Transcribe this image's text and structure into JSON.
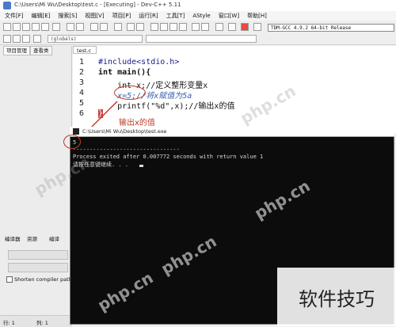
{
  "window": {
    "title": "C:\\Users\\Mi Wu\\Desktop\\test.c - [Executing] - Dev-C++ 5.11"
  },
  "menu": [
    "文件[F]",
    "编辑[E]",
    "搜索[S]",
    "视图[V]",
    "项目[P]",
    "运行[R]",
    "工具[T]",
    "AStyle",
    "窗口[W]",
    "帮助[H]"
  ],
  "toolbar": {
    "compiler": "TDM-GCC 4.9.2 64-bit Release",
    "scope": "(globals)"
  },
  "left_panel": {
    "tabs": [
      "项目管理",
      "查看类"
    ],
    "bottom_tabs": [
      "编译器",
      "资源",
      "编译"
    ],
    "shorten_label": "Shorten compiler paths",
    "status_line": "行:  1",
    "status_col": "列:  1"
  },
  "editor": {
    "tab": "test.c",
    "lines": [
      {
        "num": "1",
        "text": "#include<stdio.h>"
      },
      {
        "num": "2",
        "text": "int main(){"
      },
      {
        "num": "3",
        "text": "    int x;//定义整形变量x"
      },
      {
        "num": "4",
        "text": "    x=5;//将x赋值为5a"
      },
      {
        "num": "5",
        "text": "    printf(\"%d\",x);//输出x的值"
      },
      {
        "num": "6",
        "text": "}"
      }
    ]
  },
  "annotation": {
    "label": "输出x的值"
  },
  "console": {
    "title": "C:\\Users\\Mi Wu\\Desktop\\test.exe",
    "lines": [
      "5",
      "--------------------------------",
      "Process exited after 0.007772 seconds with return value 1",
      "请按任意键继续. . ."
    ]
  },
  "watermarks": [
    "php.cn",
    "软件技巧"
  ]
}
